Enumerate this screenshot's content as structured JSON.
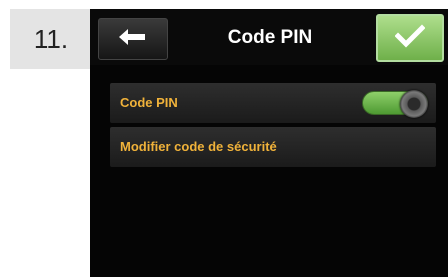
{
  "step_label": "11.",
  "header": {
    "title": "Code PIN",
    "back_icon": "arrow-left-icon",
    "confirm_icon": "checkmark-icon"
  },
  "menu": {
    "items": [
      {
        "label": "Code PIN",
        "toggle": {
          "state": "on"
        }
      },
      {
        "label": "Modifier code de sécurité"
      }
    ]
  },
  "colors": {
    "accent_text": "#f0b23a",
    "confirm_green": "#7fc05a",
    "toggle_green": "#6fbb4a"
  }
}
